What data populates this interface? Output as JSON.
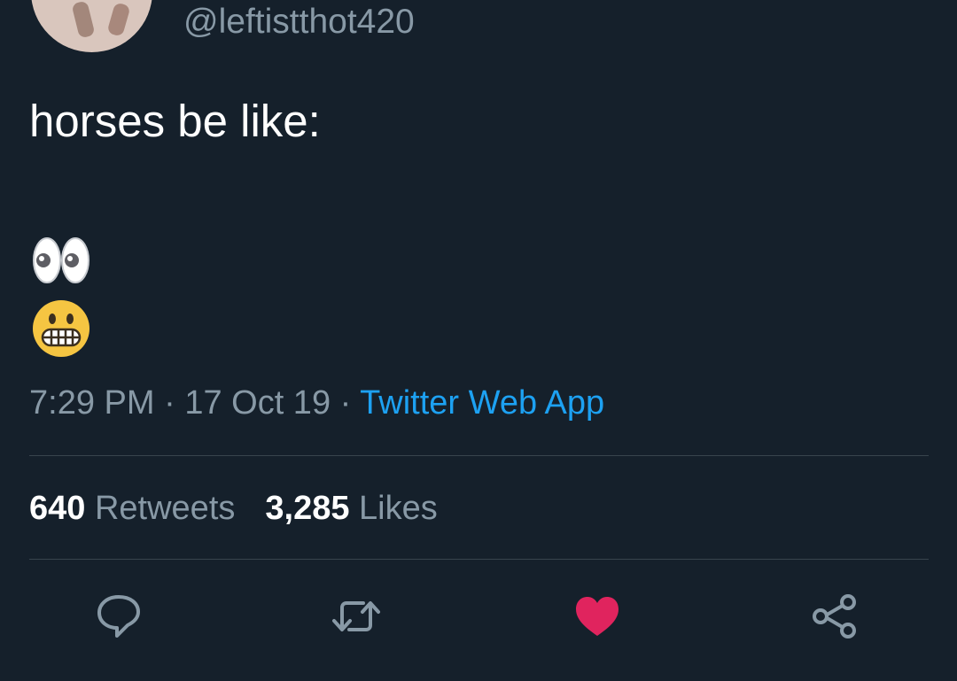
{
  "author": {
    "handle": "@leftistthot420"
  },
  "tweet": {
    "text": "horses be like:",
    "emojis": [
      "eyes",
      "grimacing-face"
    ]
  },
  "meta": {
    "time": "7:29 PM",
    "separator": "·",
    "date": "17 Oct 19",
    "source": "Twitter Web App"
  },
  "stats": {
    "retweets_count": "640",
    "retweets_label": "Retweets",
    "likes_count": "3,285",
    "likes_label": "Likes"
  },
  "actions": {
    "reply_icon": "reply-icon",
    "retweet_icon": "retweet-icon",
    "like_icon": "heart-icon",
    "share_icon": "share-icon",
    "like_active": true
  },
  "colors": {
    "background": "#15202b",
    "primary_text": "#ffffff",
    "secondary_text": "#8899a6",
    "link": "#1da1f2",
    "divider": "#38444d",
    "like": "#e0245e"
  }
}
